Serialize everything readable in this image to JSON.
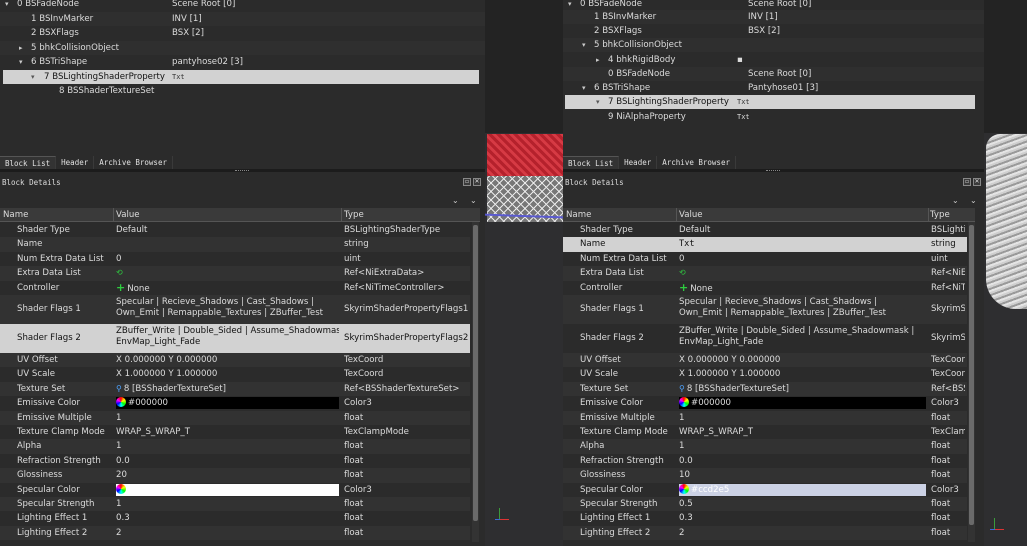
{
  "left": {
    "tree": [
      {
        "name": "0 BSFadeNode",
        "value": "Scene Root [0]",
        "indent": 0,
        "arrow": "▾"
      },
      {
        "name": "1 BSInvMarker",
        "value": "INV [1]",
        "indent": 1,
        "arrow": ""
      },
      {
        "name": "2 BSXFlags",
        "value": "BSX [2]",
        "indent": 1,
        "arrow": ""
      },
      {
        "name": "5 bhkCollisionObject",
        "value": "",
        "indent": 1,
        "arrow": "▸"
      },
      {
        "name": "6 BSTriShape",
        "value": "pantyhose02 [3]",
        "indent": 1,
        "arrow": "▾"
      },
      {
        "name": "7 BSLightingShaderProperty",
        "value": "Txt",
        "indent": 2,
        "arrow": "▾"
      },
      {
        "name": "8 BSShaderTextureSet",
        "value": "",
        "indent": 3,
        "arrow": ""
      }
    ],
    "tabs": [
      "Block List",
      "Header",
      "Archive Browser"
    ],
    "details_title": "Block Details",
    "headers": {
      "name": "Name",
      "value": "Value",
      "type": "Type"
    },
    "rows": [
      {
        "name": "Shader Type",
        "value": "Default",
        "type": "BSLightingShaderType"
      },
      {
        "name": "Name",
        "value": "",
        "type": "string"
      },
      {
        "name": "Num Extra Data List",
        "value": "0",
        "type": "uint"
      },
      {
        "name": "Extra Data List",
        "value": "",
        "type": "Ref<NiExtraData>"
      },
      {
        "name": "Controller",
        "value": "None",
        "type": "Ref<NiTimeController>"
      },
      {
        "name": "Shader Flags 1",
        "value": "Specular | Recieve_Shadows | Cast_Shadows |",
        "value2": "Own_Emit | Remappable_Textures | ZBuffer_Test",
        "type": "SkyrimShaderPropertyFlags1"
      },
      {
        "name": "Shader Flags 2",
        "value": "ZBuffer_Write | Double_Sided | Assume_Shadowmask |",
        "value2": "EnvMap_Light_Fade",
        "type": "SkyrimShaderPropertyFlags2"
      },
      {
        "name": "UV Offset",
        "value": "X 0.000000 Y 0.000000",
        "type": "TexCoord"
      },
      {
        "name": "UV Scale",
        "value": "X 1.000000 Y 1.000000",
        "type": "TexCoord"
      },
      {
        "name": "Texture Set",
        "value": "8 [BSShaderTextureSet]",
        "type": "Ref<BSShaderTextureSet>"
      },
      {
        "name": "Emissive Color",
        "value": "#000000",
        "type": "Color3"
      },
      {
        "name": "Emissive Multiple",
        "value": "1",
        "type": "float"
      },
      {
        "name": "Texture Clamp Mode",
        "value": "WRAP_S_WRAP_T",
        "type": "TexClampMode"
      },
      {
        "name": "Alpha",
        "value": "1",
        "type": "float"
      },
      {
        "name": "Refraction Strength",
        "value": "0.0",
        "type": "float"
      },
      {
        "name": "Glossiness",
        "value": "20",
        "type": "float"
      },
      {
        "name": "Specular Color",
        "value": "",
        "type": "Color3"
      },
      {
        "name": "Specular Strength",
        "value": "1",
        "type": "float"
      },
      {
        "name": "Lighting Effect 1",
        "value": "0.3",
        "type": "float"
      },
      {
        "name": "Lighting Effect 2",
        "value": "2",
        "type": "float"
      }
    ],
    "emissive_color": "#000000",
    "specular_color": "#ffffff"
  },
  "right": {
    "tree": [
      {
        "name": "0 BSFadeNode",
        "value": "Scene Root [0]",
        "indent": 0,
        "arrow": "▾"
      },
      {
        "name": "1 BSInvMarker",
        "value": "INV [1]",
        "indent": 1,
        "arrow": ""
      },
      {
        "name": "2 BSXFlags",
        "value": "BSX [2]",
        "indent": 1,
        "arrow": ""
      },
      {
        "name": "5 bhkCollisionObject",
        "value": "",
        "indent": 1,
        "arrow": "▾"
      },
      {
        "name": "4 bhkRigidBody",
        "value": "",
        "indent": 2,
        "arrow": "▸"
      },
      {
        "name": "0 BSFadeNode",
        "value": "Scene Root [0]",
        "indent": 2,
        "arrow": ""
      },
      {
        "name": "6 BSTriShape",
        "value": "Pantyhose01 [3]",
        "indent": 1,
        "arrow": "▾"
      },
      {
        "name": "7 BSLightingShaderProperty",
        "value": "Txt",
        "indent": 2,
        "arrow": "▾"
      },
      {
        "name": "9 NiAlphaProperty",
        "value": "Txt",
        "indent": 2,
        "arrow": ""
      }
    ],
    "tabs": [
      "Block List",
      "Header",
      "Archive Browser"
    ],
    "details_title": "Block Details",
    "headers": {
      "name": "Name",
      "value": "Value",
      "type": "Type"
    },
    "rows": [
      {
        "name": "Shader Type",
        "value": "Default",
        "type": "BSLightin"
      },
      {
        "name": "Name",
        "value": "Txt",
        "type": "string"
      },
      {
        "name": "Num Extra Data List",
        "value": "0",
        "type": "uint"
      },
      {
        "name": "Extra Data List",
        "value": "",
        "type": "Ref<NiEx"
      },
      {
        "name": "Controller",
        "value": "None",
        "type": "Ref<NiTi"
      },
      {
        "name": "Shader Flags 1",
        "value": "Specular | Recieve_Shadows | Cast_Shadows |",
        "value2": "Own_Emit | Remappable_Textures | ZBuffer_Test",
        "type": "SkyrimSh"
      },
      {
        "name": "Shader Flags 2",
        "value": "ZBuffer_Write | Double_Sided | Assume_Shadowmask |",
        "value2": "EnvMap_Light_Fade",
        "type": "SkyrimSh"
      },
      {
        "name": "UV Offset",
        "value": "X 0.000000 Y 0.000000",
        "type": "TexCoor"
      },
      {
        "name": "UV Scale",
        "value": "X 1.000000 Y 1.000000",
        "type": "TexCoor"
      },
      {
        "name": "Texture Set",
        "value": "8 [BSShaderTextureSet]",
        "type": "Ref<BSS"
      },
      {
        "name": "Emissive Color",
        "value": "#000000",
        "type": "Color3"
      },
      {
        "name": "Emissive Multiple",
        "value": "1",
        "type": "float"
      },
      {
        "name": "Texture Clamp Mode",
        "value": "WRAP_S_WRAP_T",
        "type": "TexClam"
      },
      {
        "name": "Alpha",
        "value": "1",
        "type": "float"
      },
      {
        "name": "Refraction Strength",
        "value": "0.0",
        "type": "float"
      },
      {
        "name": "Glossiness",
        "value": "10",
        "type": "float"
      },
      {
        "name": "Specular Color",
        "value": "#ccd2e5",
        "type": "Color3"
      },
      {
        "name": "Specular Strength",
        "value": "0.5",
        "type": "float"
      },
      {
        "name": "Lighting Effect 1",
        "value": "0.3",
        "type": "float"
      },
      {
        "name": "Lighting Effect 2",
        "value": "2",
        "type": "float"
      }
    ],
    "emissive_color": "#000000",
    "specular_color": "#ccd2e5"
  }
}
